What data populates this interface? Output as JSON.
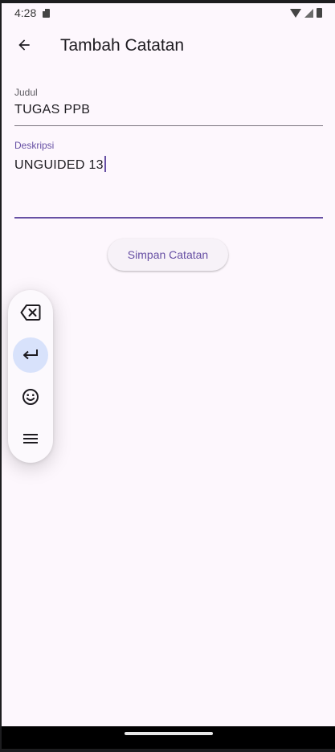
{
  "status_bar": {
    "time": "4:28"
  },
  "app_bar": {
    "title": "Tambah Catatan"
  },
  "form": {
    "title_field": {
      "label": "Judul",
      "value": "TUGAS PPB"
    },
    "description_field": {
      "label": "Deskripsi",
      "value": "UNGUIDED 13"
    }
  },
  "save_button": {
    "label": "Simpan Catatan"
  },
  "keyboard_toolbar": {
    "items": [
      "backspace-icon",
      "enter-icon",
      "emoji-icon",
      "menu-icon"
    ]
  },
  "colors": {
    "background": "#fdf7fd",
    "accent": "#6750a4",
    "divider": "#79747e",
    "active_key": "#d8e2fb"
  }
}
